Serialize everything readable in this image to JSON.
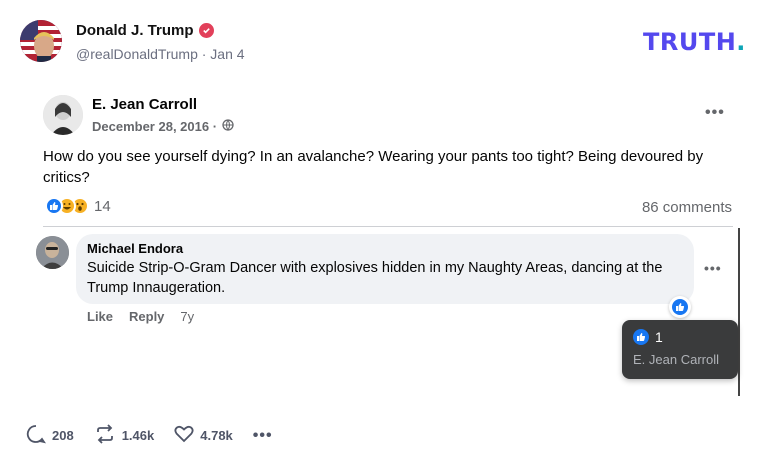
{
  "truth": {
    "author_name": "Donald J. Trump",
    "handle_line": "@realDonaldTrump · Jan 4",
    "logo_text": "TRUTH",
    "logo_dot": ".",
    "logo_color": "#5448ee",
    "accent_dot_color": "#0ea5b7",
    "verified_color": "#e2405a",
    "footer": {
      "replies": "208",
      "retruths": "1.46k",
      "likes": "4.78k",
      "more": "•••"
    }
  },
  "embedded_post": {
    "author": "E. Jean Carroll",
    "date": "December 28, 2016 ·",
    "audience_icon": "globe-icon",
    "more": "•••",
    "text": "How do you see yourself dying? In an avalanche? Wearing your pants too tight? Being devoured by critics?",
    "reaction_icons": [
      "like-icon",
      "haha-icon",
      "wow-icon"
    ],
    "reaction_count": "14",
    "comments_count": "86 comments",
    "comment": {
      "author": "Michael Endora",
      "text": "Suicide Strip-O-Gram Dancer with explosives hidden in my Naughty Areas, dancing at the Trump Innaugeration.",
      "more": "•••",
      "like_label": "Like",
      "reply_label": "Reply",
      "age": "7y"
    },
    "tooltip": {
      "count": "1",
      "name": "E. Jean Carroll"
    },
    "like_color": "#1877f2"
  }
}
